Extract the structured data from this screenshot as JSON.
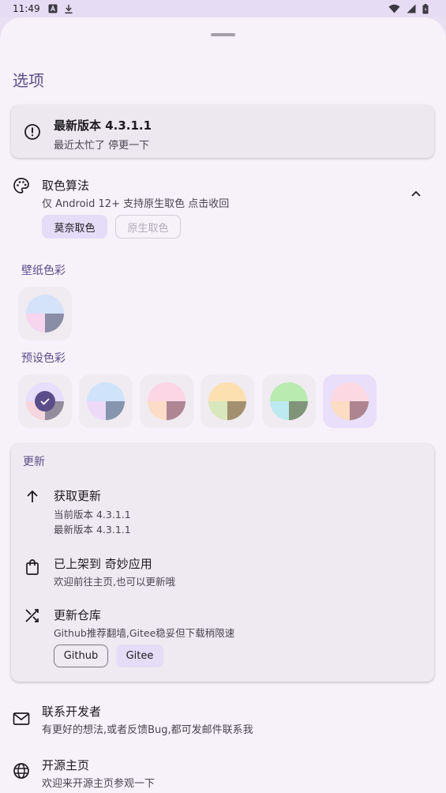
{
  "status_bar": {
    "time": "11:49"
  },
  "sheet": {
    "title": "选项"
  },
  "version_card": {
    "title": "最新版本 4.3.1.1",
    "subtitle": "最近太忙了 停更一下"
  },
  "color_algorithm": {
    "title": "取色算法",
    "subtitle": "仅 Android 12+ 支持原生取色 点击收回",
    "chips": [
      "莫奈取色",
      "原生取色"
    ],
    "selected_chip": "莫奈取色"
  },
  "wallpaper_colors": {
    "label": "壁纸色彩"
  },
  "preset_colors": {
    "label": "预设色彩"
  },
  "update_section": {
    "header": "更新",
    "get_update": {
      "title": "获取更新",
      "current": "当前版本  4.3.1.1",
      "latest": "最新版本  4.3.1.1"
    },
    "store": {
      "title": "已上架到 奇妙应用",
      "subtitle": "欢迎前往主页,也可以更新哦"
    },
    "repo": {
      "title": "更新仓库",
      "subtitle": "Github推荐翻墙,Gitee稳妥但下载稍限速",
      "buttons": [
        "Github",
        "Gitee"
      ]
    }
  },
  "contact": {
    "title": "联系开发者",
    "subtitle": "有更好的想法,或者反馈Bug,都可发邮件联系我"
  },
  "homepage": {
    "title": "开源主页",
    "subtitle": "欢迎来开源主页参观一下"
  },
  "colors": {
    "accent": "#5b4d8a",
    "sheet_bg": "#f7f1f9",
    "chip_selected": "#e5dcf7"
  },
  "icons": {
    "status": [
      "a-box-icon",
      "download-icon",
      "wifi-icon",
      "signal-icon",
      "battery-icon"
    ],
    "version": "alert-circle-icon",
    "algorithm": "palette-icon",
    "get_update": "arrow-up-icon",
    "store": "shopping-bag-icon",
    "repo": "shuffle-icon",
    "contact": "mail-icon",
    "homepage": "globe-icon"
  }
}
